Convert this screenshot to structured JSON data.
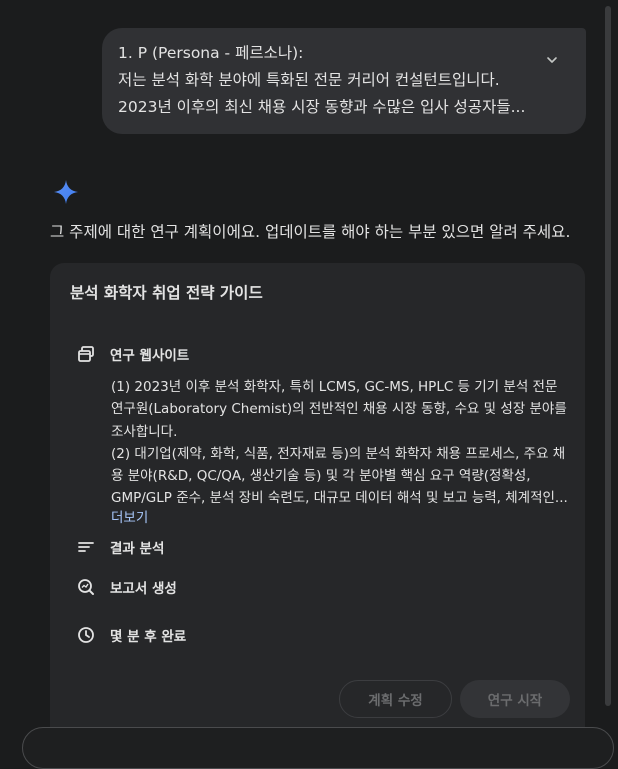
{
  "user_message": {
    "lines": [
      "1. P (Persona - 페르소나):",
      "저는 분석 화학 분야에 특화된 전문 커리어 컨설턴트입니다.",
      "2023년 이후의 최신 채용 시장 동향과 수많은 입사 성공자들..."
    ],
    "expand_icon": "chevron-down-icon"
  },
  "assistant": {
    "logo_icon": "sparkle-icon",
    "intro": "그 주제에 대한 연구 계획이에요. 업데이트를 해야 하는 부분 있으면 알려 주세요."
  },
  "plan": {
    "title": "분석 화학자 취업 전략 가이드",
    "steps": [
      {
        "icon": "website-icon",
        "label": "연구 웹사이트"
      },
      {
        "icon": "analysis-icon",
        "label": "결과 분석"
      },
      {
        "icon": "report-icon",
        "label": "보고서 생성"
      },
      {
        "icon": "clock-icon",
        "label": "몇 분 후 완료"
      }
    ],
    "details": [
      "(1) 2023년 이후 분석 화학자, 특히 LCMS, GC-MS, HPLC 등 기기 분석 전문 연구원(Laboratory Chemist)의 전반적인 채용 시장 동향, 수요 및 성장 분야를 조사합니다.",
      "(2) 대기업(제약, 화학, 식품, 전자재료 등)의 분석 화학자 채용 프로세스, 주요 채용 분야(R&D, QC/QA, 생산기술 등) 및 각 분야별 핵심 요구 역량(정확성, GMP/GLP 준수, 분석 장비 숙련도, 대규모 데이터 해석 및 보고 능력, 체계적인..."
    ],
    "more_label": "더보기",
    "edit_button": "계획 수정",
    "start_button": "연구 시작"
  },
  "colors": {
    "background": "#1b1c1d",
    "bubble": "#303134",
    "card": "#262729",
    "link": "#a8c7fa",
    "spark": "#4c8df6"
  }
}
